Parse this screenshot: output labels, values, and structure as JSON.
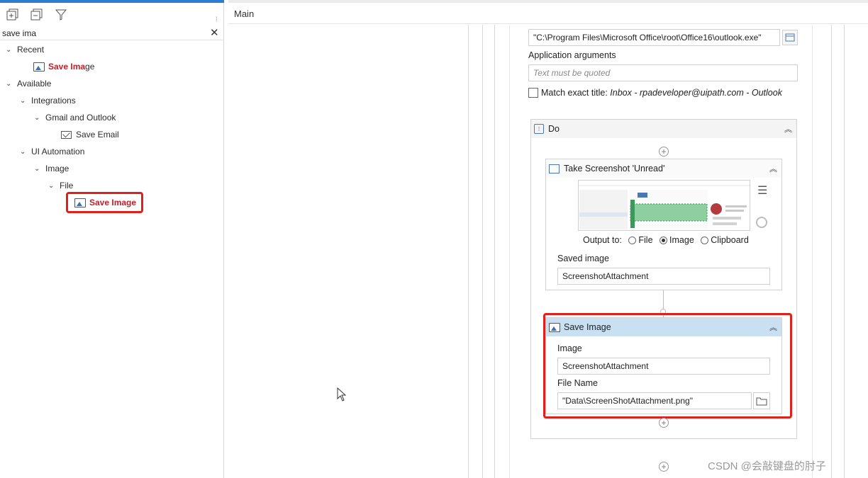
{
  "panel": {
    "search": {
      "value": "save ima"
    },
    "tree": {
      "recent": "Recent",
      "recent_item_hl": "Save Ima",
      "recent_item_rest": "ge",
      "available": "Available",
      "integrations": "Integrations",
      "gmail_outlook": "Gmail and Outlook",
      "save_email": "Save Email",
      "ui_automation": "UI Automation",
      "image": "Image",
      "file": "File",
      "save_image_hl": "Save Ima",
      "save_image_rest": "ge"
    }
  },
  "editor": {
    "tab": "Main",
    "app_path": "\"C:\\Program Files\\Microsoft Office\\root\\Office16\\outlook.exe\"",
    "app_args_label": "Application arguments",
    "app_args_placeholder": "Text must be quoted",
    "match_exact_label": "Match exact title:",
    "match_exact_value": "Inbox - rpadeveloper@uipath.com - Outlook",
    "do_title": "Do",
    "screenshot": {
      "title": "Take Screenshot 'Unread'",
      "output_to": "Output to:",
      "options": [
        "File",
        "Image",
        "Clipboard"
      ],
      "selected": "Image",
      "saved_image_label": "Saved image",
      "saved_image_value": "ScreenshotAttachment"
    },
    "save_image": {
      "title": "Save Image",
      "image_label": "Image",
      "image_value": "ScreenshotAttachment",
      "file_name_label": "File Name",
      "file_name_value": "\"Data\\ScreenShotAttachment.png\""
    }
  },
  "watermark": "CSDN @会敲键盘的肘子",
  "colors": {
    "highlight_red": "#e0201a",
    "selected_header": "#c9dff2",
    "accent_blue": "#2d7dd2"
  }
}
